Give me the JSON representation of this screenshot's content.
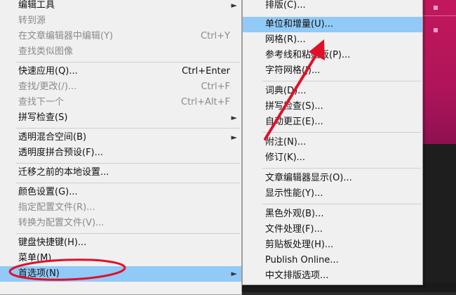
{
  "left_menu": {
    "items": [
      {
        "label": "编辑工具",
        "shortcut": "",
        "submenu": true,
        "disabled": false
      },
      {
        "label": "转到源",
        "shortcut": "",
        "submenu": false,
        "disabled": true
      },
      {
        "label": "在文章编辑器中编辑(Y)",
        "shortcut": "Ctrl+Y",
        "submenu": false,
        "disabled": true
      },
      {
        "label": "查找类似图像",
        "shortcut": "",
        "submenu": false,
        "disabled": true
      },
      {
        "label": "快速应用(Q)...",
        "shortcut": "Ctrl+Enter",
        "submenu": false,
        "disabled": false
      },
      {
        "label": "查找/更改(/)...",
        "shortcut": "Ctrl+F",
        "submenu": false,
        "disabled": true
      },
      {
        "label": "查找下一个",
        "shortcut": "Ctrl+Alt+F",
        "submenu": false,
        "disabled": true
      },
      {
        "label": "拼写检查(S)",
        "shortcut": "",
        "submenu": true,
        "disabled": false
      },
      {
        "label": "透明混合空间(B)",
        "shortcut": "",
        "submenu": true,
        "disabled": false
      },
      {
        "label": "透明度拼合预设(F)...",
        "shortcut": "",
        "submenu": false,
        "disabled": false
      },
      {
        "label": "迁移之前的本地设置...",
        "shortcut": "",
        "submenu": false,
        "disabled": false
      },
      {
        "label": "颜色设置(G)...",
        "shortcut": "",
        "submenu": false,
        "disabled": false
      },
      {
        "label": "指定配置文件(R)...",
        "shortcut": "",
        "submenu": false,
        "disabled": true
      },
      {
        "label": "转换为配置文件(V)...",
        "shortcut": "",
        "submenu": false,
        "disabled": true
      },
      {
        "label": "键盘快捷键(H)...",
        "shortcut": "",
        "submenu": false,
        "disabled": false
      },
      {
        "label": "菜单(M)...",
        "shortcut": "",
        "submenu": false,
        "disabled": false
      },
      {
        "label": "首选项(N)",
        "shortcut": "",
        "submenu": true,
        "disabled": false,
        "highlighted": true
      }
    ]
  },
  "right_menu": {
    "items": [
      {
        "label": "排版(C)...",
        "highlighted": false
      },
      {
        "label": "单位和增量(U)...",
        "highlighted": true
      },
      {
        "label": "网格(R)...",
        "highlighted": false
      },
      {
        "label": "参考线和粘贴板(P)...",
        "highlighted": false
      },
      {
        "label": "字符网格(J)...",
        "highlighted": false
      },
      {
        "label": "词典(D)...",
        "highlighted": false
      },
      {
        "label": "拼写检查(S)...",
        "highlighted": false
      },
      {
        "label": "自动更正(E)...",
        "highlighted": false
      },
      {
        "label": "附注(N)...",
        "highlighted": false
      },
      {
        "label": "修订(K)...",
        "highlighted": false
      },
      {
        "label": "文章编辑器显示(O)...",
        "highlighted": false
      },
      {
        "label": "显示性能(Y)...",
        "highlighted": false
      },
      {
        "label": "黑色外观(B)...",
        "highlighted": false
      },
      {
        "label": "文件处理(F)...",
        "highlighted": false
      },
      {
        "label": "剪贴板处理(H)...",
        "highlighted": false
      },
      {
        "label": "Publish Online...",
        "highlighted": false
      },
      {
        "label": "中文排版选项...",
        "highlighted": false
      }
    ]
  },
  "icons": {
    "submenu_arrow": "chevron-right-icon",
    "annotation_circle": "red-ellipse",
    "annotation_arrow": "red-arrow"
  },
  "colors": {
    "menu_bg": "#f0f0f0",
    "highlight": "#91c9f7",
    "disabled_text": "#8a8a8a",
    "annotation_red": "#e0102a",
    "background_accent": "#c2185b"
  }
}
